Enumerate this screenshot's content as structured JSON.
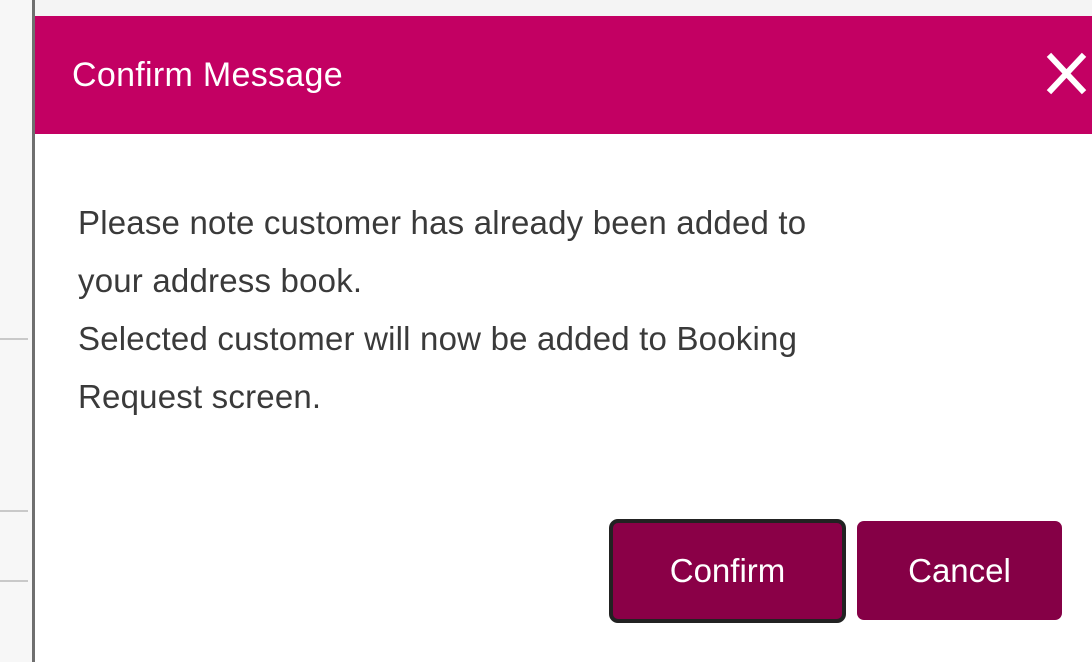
{
  "dialog": {
    "title": "Confirm Message",
    "close_icon": "close-icon",
    "message_lines": [
      "Please note customer has already been added to",
      "your address book.",
      "Selected customer will now be added to Booking",
      "Request screen."
    ],
    "confirm_label": "Confirm",
    "cancel_label": "Cancel"
  },
  "colors": {
    "header": "#c30063",
    "button": "#8a0047",
    "focus_border": "#222222",
    "text": "#3a3a3a"
  }
}
